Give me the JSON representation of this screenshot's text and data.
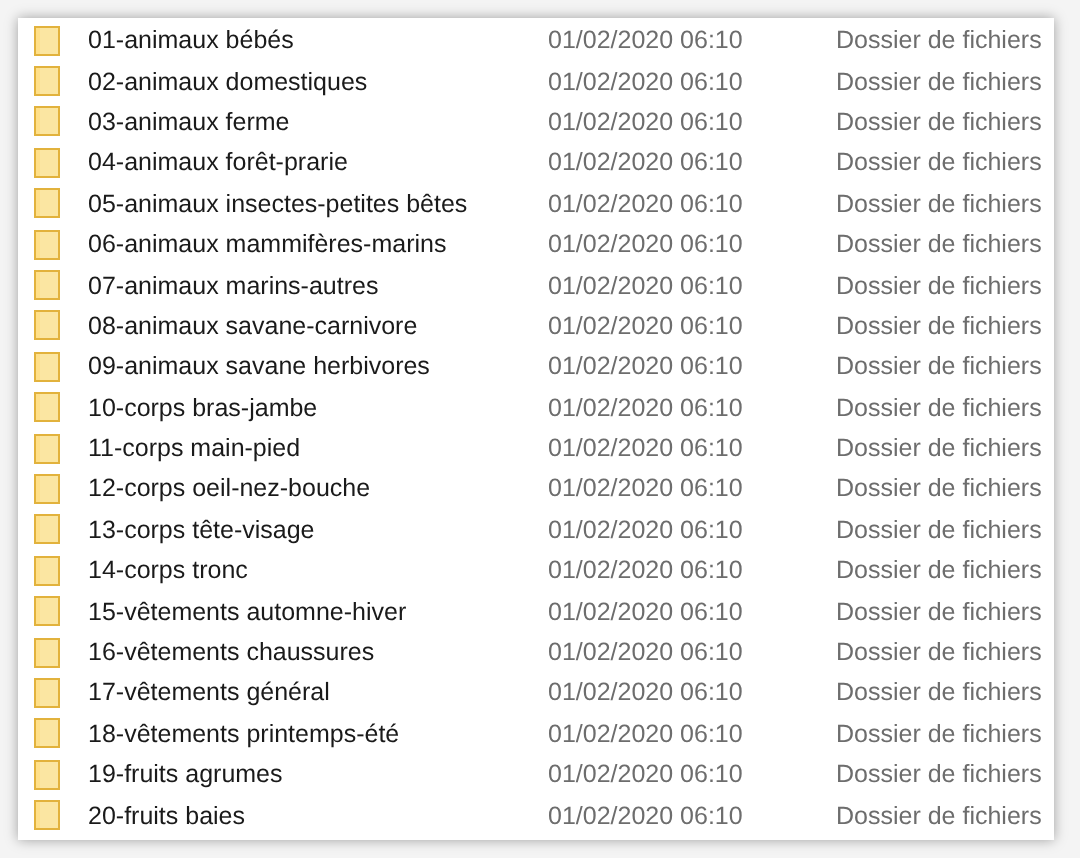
{
  "rows": [
    {
      "name": "01-animaux bébés",
      "modified": "01/02/2020 06:10",
      "type": "Dossier de fichiers"
    },
    {
      "name": "02-animaux domestiques",
      "modified": "01/02/2020 06:10",
      "type": "Dossier de fichiers"
    },
    {
      "name": "03-animaux ferme",
      "modified": "01/02/2020 06:10",
      "type": "Dossier de fichiers"
    },
    {
      "name": "04-animaux forêt-prarie",
      "modified": "01/02/2020 06:10",
      "type": "Dossier de fichiers"
    },
    {
      "name": "05-animaux insectes-petites bêtes",
      "modified": "01/02/2020 06:10",
      "type": "Dossier de fichiers"
    },
    {
      "name": "06-animaux mammifères-marins",
      "modified": "01/02/2020 06:10",
      "type": "Dossier de fichiers"
    },
    {
      "name": "07-animaux marins-autres",
      "modified": "01/02/2020 06:10",
      "type": "Dossier de fichiers"
    },
    {
      "name": "08-animaux savane-carnivore",
      "modified": "01/02/2020 06:10",
      "type": "Dossier de fichiers"
    },
    {
      "name": "09-animaux savane herbivores",
      "modified": "01/02/2020 06:10",
      "type": "Dossier de fichiers"
    },
    {
      "name": "10-corps bras-jambe",
      "modified": "01/02/2020 06:10",
      "type": "Dossier de fichiers"
    },
    {
      "name": "11-corps main-pied",
      "modified": "01/02/2020 06:10",
      "type": "Dossier de fichiers"
    },
    {
      "name": "12-corps oeil-nez-bouche",
      "modified": "01/02/2020 06:10",
      "type": "Dossier de fichiers"
    },
    {
      "name": "13-corps tête-visage",
      "modified": "01/02/2020 06:10",
      "type": "Dossier de fichiers"
    },
    {
      "name": "14-corps tronc",
      "modified": "01/02/2020 06:10",
      "type": "Dossier de fichiers"
    },
    {
      "name": "15-vêtements automne-hiver",
      "modified": "01/02/2020 06:10",
      "type": "Dossier de fichiers"
    },
    {
      "name": "16-vêtements chaussures",
      "modified": "01/02/2020 06:10",
      "type": "Dossier de fichiers"
    },
    {
      "name": "17-vêtements général",
      "modified": "01/02/2020 06:10",
      "type": "Dossier de fichiers"
    },
    {
      "name": "18-vêtements printemps-été",
      "modified": "01/02/2020 06:10",
      "type": "Dossier de fichiers"
    },
    {
      "name": "19-fruits agrumes",
      "modified": "01/02/2020 06:10",
      "type": "Dossier de fichiers"
    },
    {
      "name": "20-fruits baies",
      "modified": "01/02/2020 06:10",
      "type": "Dossier de fichiers"
    }
  ]
}
